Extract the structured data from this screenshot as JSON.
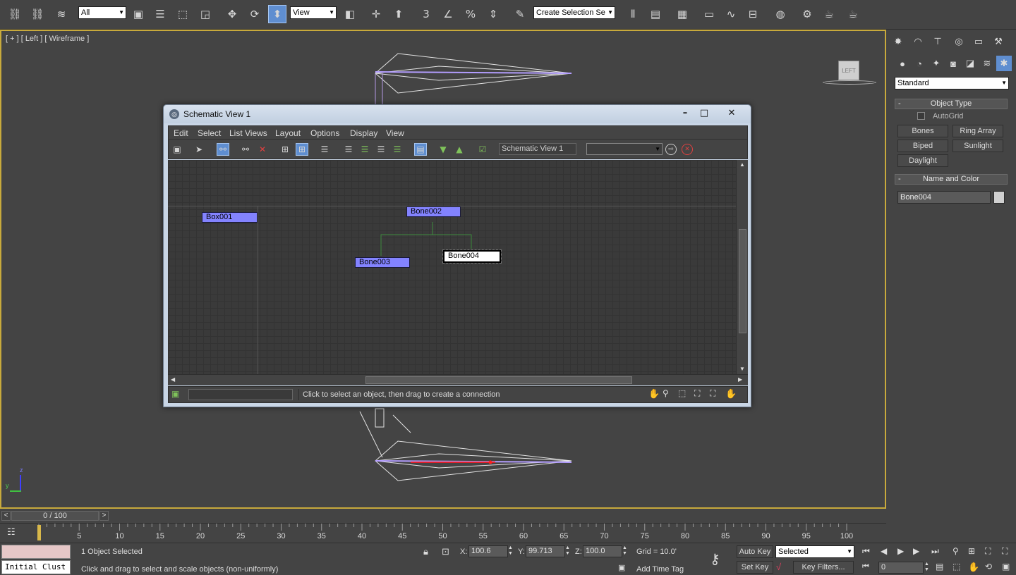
{
  "toolbar": {
    "selection_filter": "All",
    "ref_coord": "View",
    "named_selection": "Create Selection Se"
  },
  "viewport": {
    "label": "[ + ] [ Left ] [ Wireframe ]",
    "viewcube_label": "LEFT",
    "axis_z": "z",
    "axis_y": "y"
  },
  "command_panel": {
    "category": "Standard",
    "object_type": {
      "title": "Object Type",
      "autogrid": "AutoGrid",
      "buttons": [
        "Bones",
        "Ring Array",
        "Biped",
        "Sunlight",
        "Daylight"
      ]
    },
    "name_and_color": {
      "title": "Name and Color",
      "name_value": "Bone004"
    }
  },
  "schematic": {
    "title": "Schematic View 1",
    "menus": [
      "Edit",
      "Select",
      "List Views",
      "Layout",
      "Options",
      "Display",
      "View"
    ],
    "view_name": "Schematic View 1",
    "status_text": "Click to select an object, then drag to create a connection",
    "nodes": {
      "box001": "Box001",
      "bone002": "Bone002",
      "bone003": "Bone003",
      "bone004": "Bone004"
    }
  },
  "time": {
    "frame_counter": "0 / 100",
    "prev": "<",
    "next": ">",
    "ticks": [
      "5",
      "10",
      "15",
      "20",
      "25",
      "30",
      "35",
      "40",
      "45",
      "50",
      "55",
      "60",
      "65",
      "70",
      "75",
      "80",
      "85",
      "90",
      "95",
      "100"
    ]
  },
  "status": {
    "maxscript_value": "Initial Clust",
    "selection_info": "1 Object Selected",
    "prompt": "Click and drag to select and scale objects (non-uniformly)",
    "x_label": "X:",
    "x_value": "100.6",
    "y_label": "Y:",
    "y_value": "99.713",
    "z_label": "Z:",
    "z_value": "100.0",
    "grid": "Grid = 10.0'",
    "add_time_tag": "Add Time Tag",
    "auto_key": "Auto Key",
    "set_key": "Set Key",
    "key_mode": "Selected",
    "key_filters": "Key Filters...",
    "frame_value": "0"
  },
  "colors": {
    "viewport_border": "#c8aa3c",
    "node_fill": "#8383ff",
    "active_button": "#5f8ed0"
  }
}
